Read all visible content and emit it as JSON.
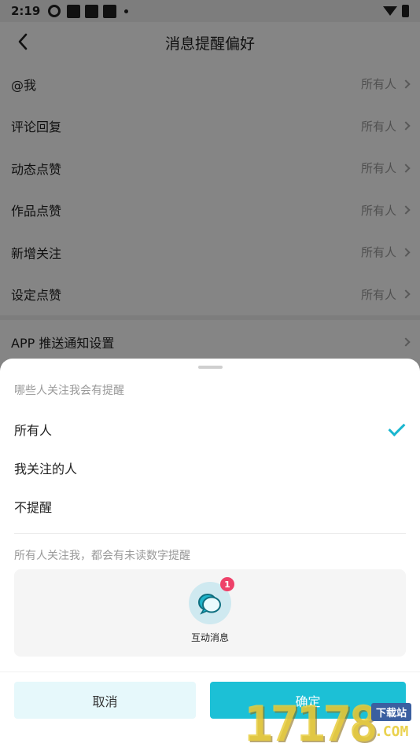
{
  "status_bar": {
    "time": "2:19"
  },
  "nav": {
    "title": "消息提醒偏好"
  },
  "settings_rows": [
    {
      "label": "@我",
      "value": "所有人"
    },
    {
      "label": "评论回复",
      "value": "所有人"
    },
    {
      "label": "动态点赞",
      "value": "所有人"
    },
    {
      "label": "作品点赞",
      "value": "所有人"
    },
    {
      "label": "新增关注",
      "value": "所有人"
    },
    {
      "label": "设定点赞",
      "value": "所有人"
    }
  ],
  "push_row": {
    "label": "APP 推送通知设置"
  },
  "sheet": {
    "question": "哪些人关注我会有提醒",
    "options": [
      {
        "label": "所有人",
        "selected": true
      },
      {
        "label": "我关注的人",
        "selected": false
      },
      {
        "label": "不提醒",
        "selected": false
      }
    ],
    "preview_text": "所有人关注我，都会有未读数字提醒",
    "preview_badge": "1",
    "preview_label": "互动消息",
    "cancel_label": "取消",
    "confirm_label": "确定"
  },
  "watermark": {
    "number": "17178",
    "tag": "下载站",
    "domain": ".COM"
  },
  "colors": {
    "accent": "#1cc0d6",
    "badge": "#ee4169",
    "cancel_bg": "#e6f8fb"
  }
}
